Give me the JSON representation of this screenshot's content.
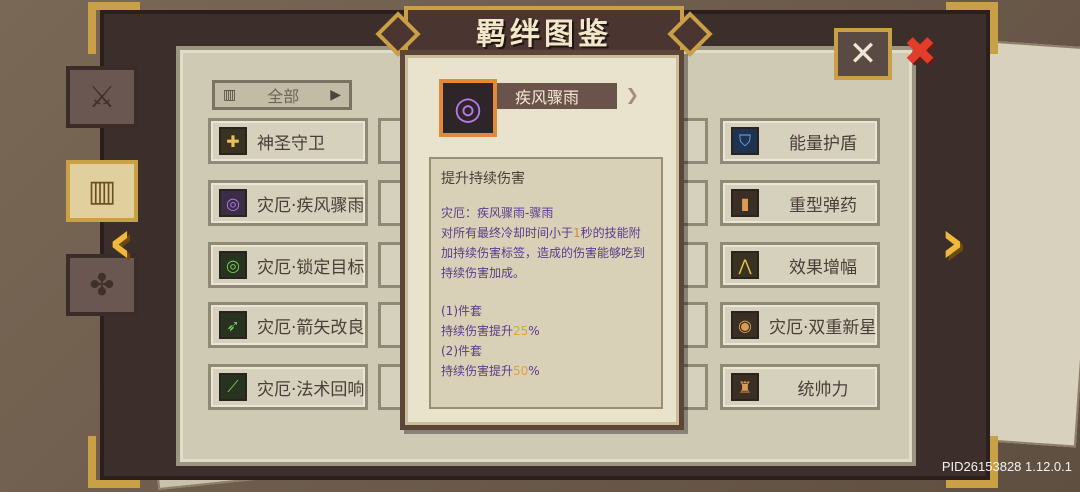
{
  "title": "羁绊图鉴",
  "close_label": "✕",
  "filter": {
    "label": "全部"
  },
  "left_items": [
    {
      "label": "神圣守卫",
      "icon": "shield-icon",
      "glyph": "✚",
      "color": "gold"
    },
    {
      "label": "灾厄·疾风骤雨",
      "icon": "tornado-icon",
      "glyph": "◎",
      "color": "purple"
    },
    {
      "label": "灾厄·锁定目标",
      "icon": "target-icon",
      "glyph": "◎",
      "color": "green"
    },
    {
      "label": "灾厄·箭矢改良",
      "icon": "arrow-icon",
      "glyph": "➶",
      "color": "green"
    },
    {
      "label": "灾厄·法术回响",
      "icon": "staff-icon",
      "glyph": "⟋",
      "color": "green"
    }
  ],
  "right_items": [
    {
      "label": "能量护盾",
      "icon": "energy-shield-icon",
      "glyph": "⛉",
      "color": "blue"
    },
    {
      "label": "重型弹药",
      "icon": "bullet-icon",
      "glyph": "▮",
      "color": "brown"
    },
    {
      "label": "效果增幅",
      "icon": "amplify-icon",
      "glyph": "⋀",
      "color": "gold"
    },
    {
      "label": "灾厄·双重新星",
      "icon": "nova-icon",
      "glyph": "◉",
      "color": "brown"
    },
    {
      "label": "统帅力",
      "icon": "commander-icon",
      "glyph": "♜",
      "color": "brown"
    }
  ],
  "popup": {
    "name": "疾风骤雨",
    "heading": "提升持续伤害",
    "subtitle": "灾厄：疾风骤雨-骤雨",
    "desc_pre": "对所有最终冷却时间小于",
    "desc_num": "1",
    "desc_post": "秒的技能附加持续伤害标签，造成的伤害能够吃到持续伤害加成。",
    "set1_label": "(1)件套",
    "set1_text": "持续伤害提升",
    "set1_value": "25",
    "set1_unit": "%",
    "set2_label": "(2)件套",
    "set2_text": "持续伤害提升",
    "set2_value": "50",
    "set2_unit": "%"
  },
  "version": "PID26153828 1.12.0.1"
}
